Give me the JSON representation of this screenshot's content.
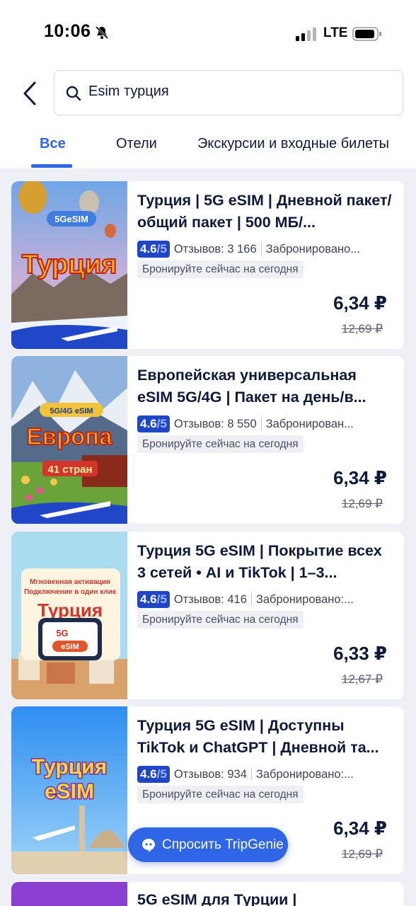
{
  "status_bar": {
    "time": "10:06",
    "network": "LTE"
  },
  "search": {
    "value": "Esim турция"
  },
  "tabs": [
    {
      "label": "Все",
      "active": true
    },
    {
      "label": "Отели",
      "active": false
    },
    {
      "label": "Экскурсии и входные билеты",
      "active": false
    }
  ],
  "results": [
    {
      "title": "Турция | 5G eSIM | Дневной пакет/общий пакет | 500 МБ/...",
      "rating": "4.6",
      "rating_of": "/5",
      "reviews": "Отзывов: 3 166",
      "booked": "Забронировано...",
      "tag": "Бронируйте сейчас на сегодня",
      "price": "6,34 ₽",
      "old_price": "12,69 ₽",
      "image": {
        "badge": "5GeSIM",
        "label": "Турция"
      }
    },
    {
      "title": "Европейская универсальная eSIM 5G/4G | Пакет на день/в...",
      "rating": "4.6",
      "rating_of": "/5",
      "reviews": "Отзывов: 8 550",
      "booked": "Забронирован...",
      "tag": "Бронируйте сейчас на сегодня",
      "price": "6,34 ₽",
      "old_price": "12,69 ₽",
      "image": {
        "badge": "5G/4G eSIM",
        "label": "Европа",
        "sublabel": "41 стран"
      }
    },
    {
      "title": "Турция 5G eSIM | Покрытие всех 3 сетей • AI и TikTok | 1–3...",
      "rating": "4.6",
      "rating_of": "/5",
      "reviews": "Отзывов: 416",
      "booked": "Забронировано:...",
      "tag": "Бронируйте сейчас на сегодня",
      "price": "6,33 ₽",
      "old_price": "12,67 ₽",
      "image": {
        "line1": "Мгновенная активация",
        "line2": "Подключение в один клик",
        "label": "Турция",
        "badge": "5G",
        "badge2": "eSIM"
      }
    },
    {
      "title": "Турция 5G eSIM | Доступны TikTok и ChatGPT | Дневной та...",
      "rating": "4.6",
      "rating_of": "/5",
      "reviews": "Отзывов: 934",
      "booked": "Забронировано:...",
      "tag": "Бронируйте сейчас на сегодня",
      "price": "6,34 ₽",
      "old_price": "12,69 ₽",
      "image": {
        "label": "Турция",
        "label2": "eSIM"
      }
    },
    {
      "title": "5G eSIM для Турции |"
    }
  ],
  "assistant": {
    "label": "Спросить TripGenie"
  },
  "colors": {
    "accent": "#2f66e8",
    "rating_bg": "#2046c8"
  }
}
